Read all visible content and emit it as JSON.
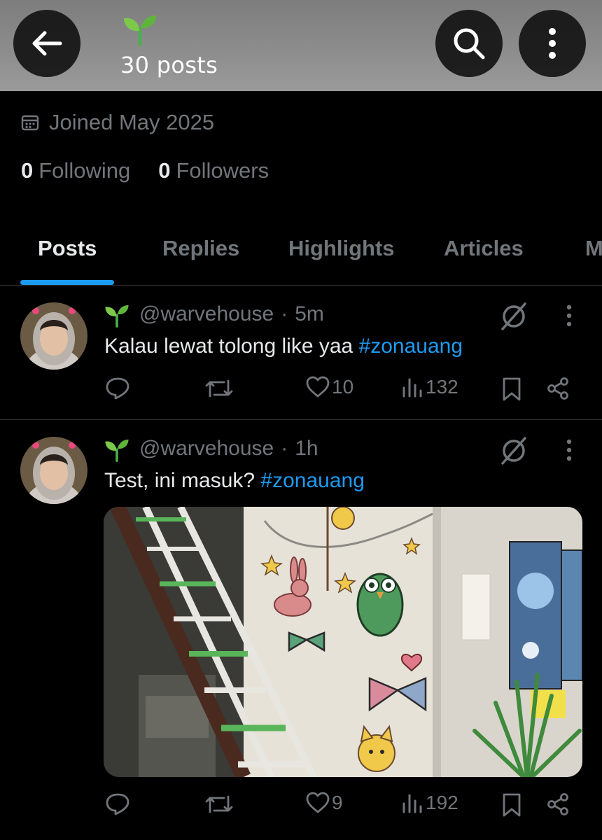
{
  "header": {
    "back_icon": "arrow-left-icon",
    "profile_emoji": "seedling",
    "post_count": "30 posts",
    "search_icon": "search-icon",
    "more_icon": "more-vertical-icon"
  },
  "profile": {
    "joined": "Joined May 2025",
    "following_count": "0",
    "following_label": "Following",
    "followers_count": "0",
    "followers_label": "Followers"
  },
  "tabs": [
    {
      "label": "Posts",
      "active": true
    },
    {
      "label": "Replies",
      "active": false
    },
    {
      "label": "Highlights",
      "active": false
    },
    {
      "label": "Articles",
      "active": false
    },
    {
      "label": "M",
      "active": false
    }
  ],
  "colors": {
    "accent": "#1d9bf0",
    "muted": "#71767b",
    "text": "#e7e9ea",
    "background": "#000000"
  },
  "posts": [
    {
      "handle": "@warvehouse",
      "separator": "·",
      "time": "5m",
      "text": "Kalau lewat tolong like yaa ",
      "hashtag": "#zonauang",
      "likes": "10",
      "views": "132",
      "has_media": false
    },
    {
      "handle": "@warvehouse",
      "separator": "·",
      "time": "1h",
      "text": "Test, ini masuk? ",
      "hashtag": "#zonauang",
      "likes": "9",
      "views": "192",
      "has_media": true
    }
  ]
}
